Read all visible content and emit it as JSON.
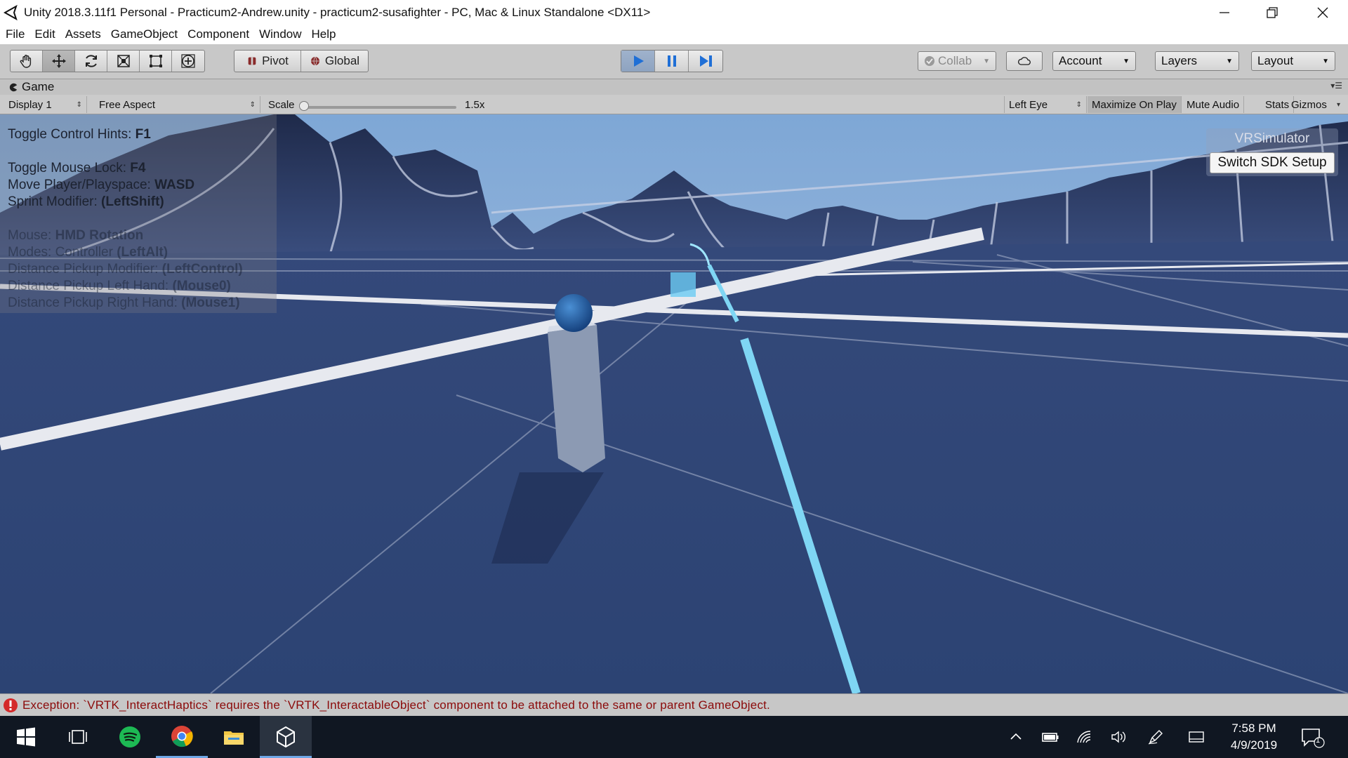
{
  "window": {
    "title": "Unity 2018.3.11f1 Personal - Practicum2-Andrew.unity - practicum2-susafighter - PC, Mac & Linux Standalone <DX11>",
    "controls": [
      "minimize-icon",
      "restore-icon",
      "close-icon"
    ]
  },
  "menu": {
    "items": [
      "File",
      "Edit",
      "Assets",
      "GameObject",
      "Component",
      "Window",
      "Help"
    ]
  },
  "toolbar": {
    "transform_tools": [
      "hand-icon",
      "move-icon",
      "rotate-icon",
      "scale-icon",
      "rect-icon",
      "transform-icon"
    ],
    "pivot_label": "Pivot",
    "global_label": "Global",
    "play_controls": [
      "play-icon",
      "pause-icon",
      "step-icon"
    ],
    "collab_label": "Collab",
    "account_label": "Account",
    "layers_label": "Layers",
    "layout_label": "Layout"
  },
  "game_tab": {
    "label": "Game"
  },
  "game_bar": {
    "display": "Display 1",
    "aspect": "Free Aspect",
    "scale_label": "Scale",
    "scale_value": "1.5x",
    "scale_fraction": 0.0,
    "eye": "Left Eye",
    "maximize": "Maximize On Play",
    "mute": "Mute Audio",
    "stats": "Stats",
    "gizmos": "Gizmos"
  },
  "hints": {
    "lines": [
      {
        "label": "Toggle Control Hints: ",
        "key": "F1",
        "faded": false
      },
      {
        "label": "Toggle Mouse Lock: ",
        "key": "F4",
        "faded": false
      },
      {
        "label": "Move Player/Playspace: ",
        "key": "WASD",
        "faded": false
      },
      {
        "label": "Sprint Modifier: ",
        "key": "(LeftShift)",
        "faded": false
      },
      {
        "label": "Mouse: ",
        "key": "HMD Rotation",
        "faded": true
      },
      {
        "label": "Modes: Controller ",
        "key": "(LeftAlt)",
        "faded": true
      },
      {
        "label": "Distance Pickup Modifier: ",
        "key": "(LeftControl)",
        "faded": true
      },
      {
        "label": "Distance Pickup Left Hand: ",
        "key": "(Mouse0)",
        "faded": true
      },
      {
        "label": "Distance Pickup Right Hand: ",
        "key": "(Mouse1)",
        "faded": true
      }
    ]
  },
  "vrsim": {
    "title": "VRSimulator",
    "button": "Switch SDK Setup"
  },
  "status": {
    "message": "Exception: `VRTK_InteractHaptics` requires the `VRTK_InteractableObject` component to be attached to the same or parent GameObject."
  },
  "taskbar": {
    "apps": [
      "windows-start-icon",
      "task-view-icon",
      "spotify-icon",
      "chrome-icon",
      "file-explorer-icon",
      "unity-icon"
    ],
    "time": "7:58 PM",
    "date": "4/9/2019",
    "notifications": "1"
  },
  "colors": {
    "sky_top": "#7ea7d6",
    "ground": "#2f4777",
    "terrain": "#27345a",
    "grid": "#d9dfe8",
    "beam": "#7fd6f4",
    "error": "#8b0a0a"
  }
}
